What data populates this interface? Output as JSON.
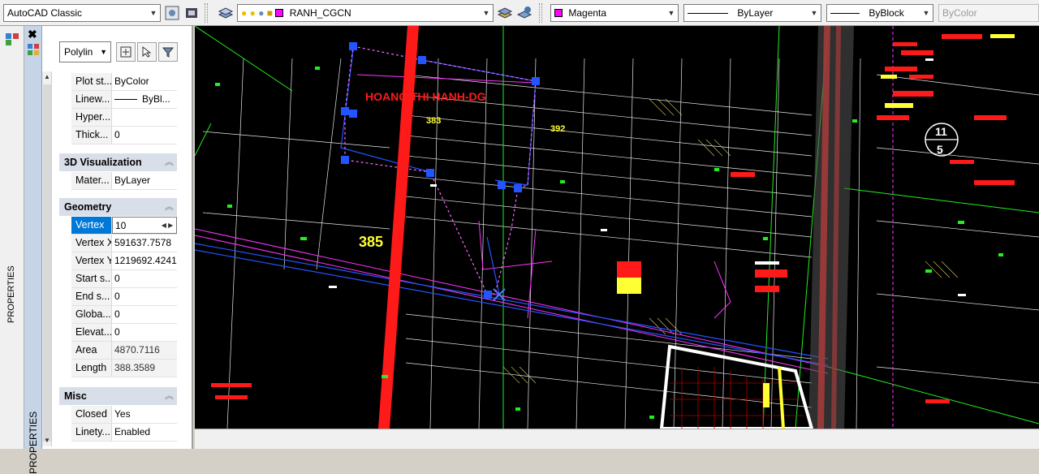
{
  "toolbar": {
    "workspace": "AutoCAD Classic",
    "layer": "RANH_CGCN",
    "color": "Magenta",
    "linetype": "ByLayer",
    "lineweight": "ByBlock",
    "plotstyle": "ByColor"
  },
  "palette": {
    "title": "PROPERTIES",
    "object_type": "Polylin"
  },
  "sections": {
    "general_rows": [
      {
        "key": "Plot st...",
        "value": "ByColor"
      },
      {
        "key": "Linew...",
        "value": "ByBl..."
      },
      {
        "key": "Hyper...",
        "value": ""
      },
      {
        "key": "Thick...",
        "value": "0"
      }
    ],
    "viz": {
      "title": "3D Visualization",
      "rows": [
        {
          "key": "Mater...",
          "value": "ByLayer"
        }
      ]
    },
    "geometry": {
      "title": "Geometry",
      "rows": [
        {
          "key": "Vertex",
          "value": "10"
        },
        {
          "key": "Vertex X",
          "value": "591637.7578"
        },
        {
          "key": "Vertex Y",
          "value": "1219692.4241"
        },
        {
          "key": "Start s...",
          "value": "0"
        },
        {
          "key": "End s...",
          "value": "0"
        },
        {
          "key": "Globa...",
          "value": "0"
        },
        {
          "key": "Elevat...",
          "value": "0"
        },
        {
          "key": "Area",
          "value": "4870.7116"
        },
        {
          "key": "Length",
          "value": "388.3589"
        }
      ]
    },
    "misc": {
      "title": "Misc",
      "rows": [
        {
          "key": "Closed",
          "value": "Yes"
        },
        {
          "key": "Linety...",
          "value": "Enabled"
        }
      ]
    }
  },
  "drawing": {
    "labels": [
      "HOANG THI HANH-DG",
      "383",
      "392",
      "385",
      "11",
      "5"
    ],
    "colors": {
      "bg": "#000000",
      "red": "#ff1a1a",
      "yellow": "#ffff33",
      "green": "#22ee22",
      "magenta": "#ff33ff",
      "blue": "#2255ff",
      "white": "#ffffff"
    }
  }
}
